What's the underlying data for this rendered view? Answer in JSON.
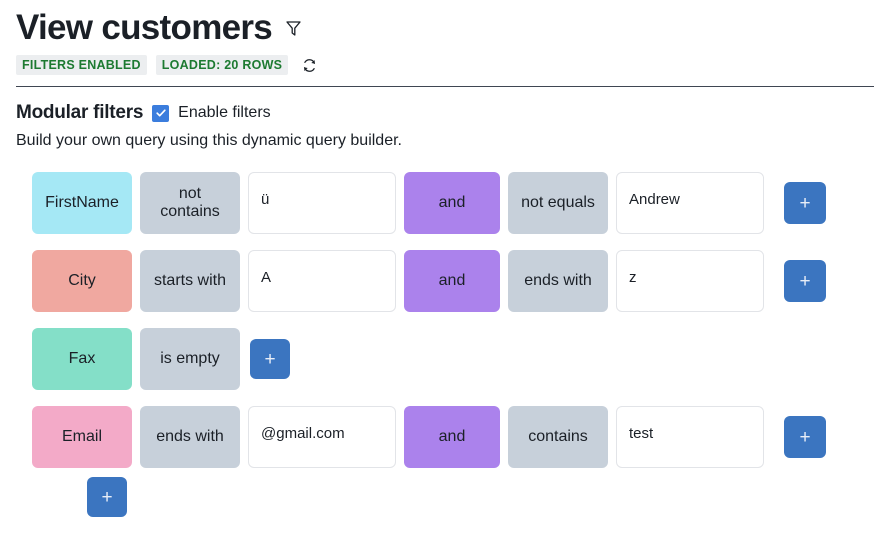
{
  "header": {
    "title": "View customers",
    "filter_icon": "funnel-icon",
    "badges": [
      {
        "label": "FILTERS ENABLED"
      },
      {
        "label": "LOADED: 20 ROWS"
      }
    ],
    "refresh_icon": "refresh-icon"
  },
  "section": {
    "title": "Modular filters",
    "checkbox_checked": true,
    "checkbox_label": "Enable filters",
    "subtitle": "Build your own query using this dynamic query builder."
  },
  "colors": {
    "accent_blue": "#3b75c0",
    "checkbox_blue": "#3b7ddd",
    "conjunction_purple": "#ab82ec",
    "operator_gray": "#c7d0da",
    "badge_bg": "#eceef0",
    "badge_text": "#1d7a31",
    "field_firstname": "#a5e8f5",
    "field_city": "#f0a8a0",
    "field_fax": "#84dfc8",
    "field_email": "#f3aac8"
  },
  "add_button_label": "+",
  "filter_rows": [
    {
      "field": "FirstName",
      "field_color": "#a5e8f5",
      "conditions": [
        {
          "operator": "not contains",
          "value": "ü",
          "has_value_input": true
        },
        {
          "conjunction": "and",
          "operator": "not equals",
          "value": "Andrew",
          "has_value_input": true
        }
      ],
      "add_condition_label": "+",
      "inline_add": false
    },
    {
      "field": "City",
      "field_color": "#f0a8a0",
      "conditions": [
        {
          "operator": "starts with",
          "value": "A",
          "has_value_input": true
        },
        {
          "conjunction": "and",
          "operator": "ends with",
          "value": "z",
          "has_value_input": true
        }
      ],
      "add_condition_label": "+",
      "inline_add": false
    },
    {
      "field": "Fax",
      "field_color": "#84dfc8",
      "conditions": [
        {
          "operator": "is empty",
          "value": "",
          "has_value_input": false
        }
      ],
      "add_condition_label": "+",
      "inline_add": true
    },
    {
      "field": "Email",
      "field_color": "#f3aac8",
      "conditions": [
        {
          "operator": "ends with",
          "value": "@gmail.com",
          "has_value_input": true
        },
        {
          "conjunction": "and",
          "operator": "contains",
          "value": "test",
          "has_value_input": true
        }
      ],
      "add_condition_label": "+",
      "inline_add": false
    }
  ],
  "add_filter_row_label": "+"
}
